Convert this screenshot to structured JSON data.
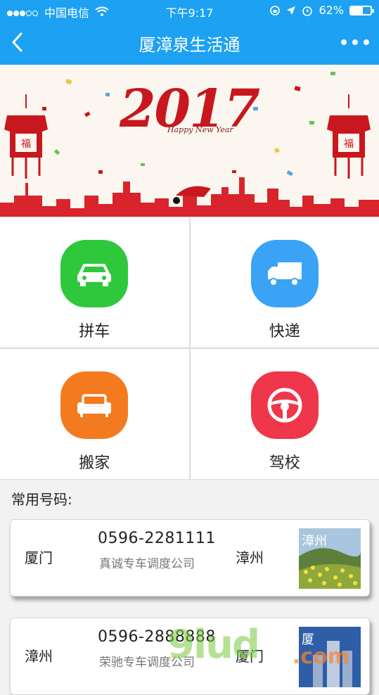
{
  "status": {
    "carrier": "中国电信",
    "time": "下午9:17",
    "battery": "62%",
    "battery_level": 0.62
  },
  "nav": {
    "title": "厦漳泉生活通",
    "back_icon": "chevron-left-icon",
    "more_icon": "more-dots-icon"
  },
  "banner": {
    "year": "2017",
    "subtitle": "Happy New Year"
  },
  "services": [
    {
      "label": "拼车",
      "icon": "car-icon",
      "color": "#2fc83c"
    },
    {
      "label": "快递",
      "icon": "truck-icon",
      "color": "#3aa3f5"
    },
    {
      "label": "搬家",
      "icon": "sofa-icon",
      "color": "#f47a20"
    },
    {
      "label": "驾校",
      "icon": "steering-wheel-icon",
      "color": "#f0364a"
    }
  ],
  "common_numbers": {
    "title": "常用号码:",
    "cards": [
      {
        "from": "厦门",
        "phone": "0596-2281111",
        "company": "真诚专车调度公司",
        "to": "漳州",
        "thumb_text": "漳州"
      },
      {
        "from": "漳州",
        "phone": "0596-2888888",
        "company": "荣驰专车调度公司",
        "to": "厦门",
        "thumb_text": "厦"
      }
    ]
  },
  "watermark": {
    "main": "9lud",
    "suffix": ".com"
  },
  "colors": {
    "header": "#1da1f2",
    "accent_red": "#c8171e"
  }
}
